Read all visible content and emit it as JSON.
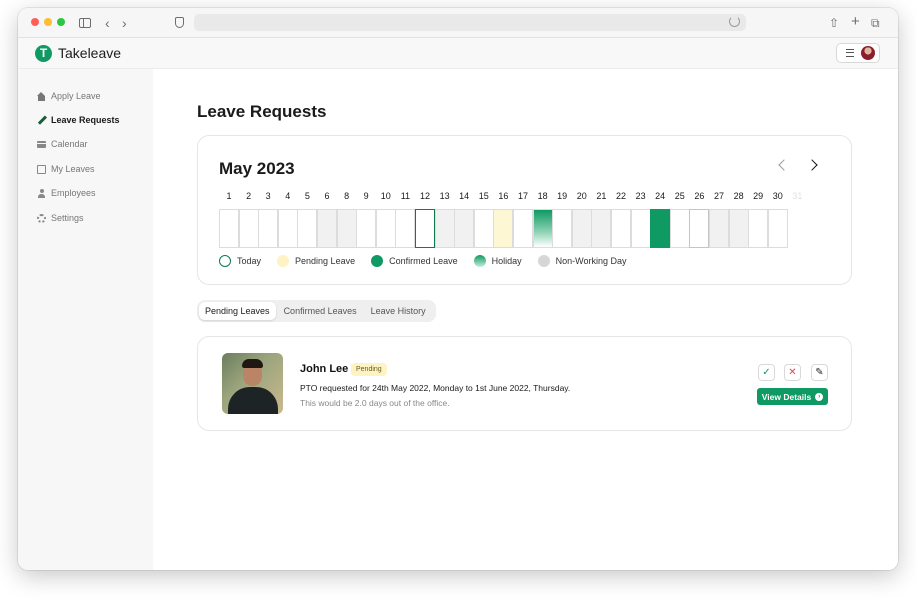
{
  "app": {
    "brand": "Takeleave",
    "logo_letter": "T"
  },
  "sidebar": {
    "items": [
      {
        "label": "Apply Leave",
        "icon": "home-icon",
        "active": false
      },
      {
        "label": "Leave Requests",
        "icon": "pencil-icon",
        "active": true
      },
      {
        "label": "Calendar",
        "icon": "calendar-icon",
        "active": false
      },
      {
        "label": "My Leaves",
        "icon": "book-icon",
        "active": false
      },
      {
        "label": "Employees",
        "icon": "user-icon",
        "active": false
      },
      {
        "label": "Settings",
        "icon": "gear-icon",
        "active": false
      }
    ]
  },
  "page": {
    "title": "Leave Requests"
  },
  "calendar": {
    "month_label": "May 2023",
    "days": [
      {
        "d": "1",
        "s": "normal"
      },
      {
        "d": "2",
        "s": "normal"
      },
      {
        "d": "3",
        "s": "normal"
      },
      {
        "d": "4",
        "s": "normal"
      },
      {
        "d": "5",
        "s": "normal"
      },
      {
        "d": "6",
        "s": "nonwork"
      },
      {
        "d": "8",
        "s": "nonwork"
      },
      {
        "d": "9",
        "s": "normal"
      },
      {
        "d": "10",
        "s": "normal"
      },
      {
        "d": "11",
        "s": "normal"
      },
      {
        "d": "12",
        "s": "today"
      },
      {
        "d": "13",
        "s": "nonwork"
      },
      {
        "d": "14",
        "s": "nonwork"
      },
      {
        "d": "15",
        "s": "normal"
      },
      {
        "d": "16",
        "s": "pending"
      },
      {
        "d": "17",
        "s": "normal"
      },
      {
        "d": "18",
        "s": "holiday"
      },
      {
        "d": "19",
        "s": "normal"
      },
      {
        "d": "20",
        "s": "nonwork"
      },
      {
        "d": "21",
        "s": "nonwork"
      },
      {
        "d": "22",
        "s": "normal"
      },
      {
        "d": "23",
        "s": "normal"
      },
      {
        "d": "24",
        "s": "confirmed"
      },
      {
        "d": "25",
        "s": "normal"
      },
      {
        "d": "26",
        "s": "outlined"
      },
      {
        "d": "27",
        "s": "nonwork"
      },
      {
        "d": "28",
        "s": "nonwork"
      },
      {
        "d": "29",
        "s": "normal"
      },
      {
        "d": "30",
        "s": "normal"
      },
      {
        "d": "31",
        "s": "faded"
      }
    ],
    "legend": [
      {
        "label": "Today",
        "key": "today"
      },
      {
        "label": "Pending Leave",
        "key": "pending"
      },
      {
        "label": "Confirmed Leave",
        "key": "confirmed"
      },
      {
        "label": "Holiday",
        "key": "holiday"
      },
      {
        "label": "Non-Working Day",
        "key": "nonwork"
      }
    ]
  },
  "tabs": [
    {
      "label": "Pending Leaves",
      "active": true
    },
    {
      "label": "Confirmed Leaves",
      "active": false
    },
    {
      "label": "Leave History",
      "active": false
    }
  ],
  "request": {
    "name": "John Lee",
    "status": "Pending",
    "description": "PTO requested for 24th May 2022, Monday to 1st June 2022, Thursday.",
    "subdescription": "This would be 2.0 days out of the office.",
    "approve_glyph": "✓",
    "reject_glyph": "✕",
    "edit_glyph": "✎",
    "view_label": "View Details",
    "view_arrow": "›"
  },
  "colors": {
    "accent": "#0e9a62",
    "pending": "#fdf3c4",
    "nonwork": "#f1f1f1"
  }
}
